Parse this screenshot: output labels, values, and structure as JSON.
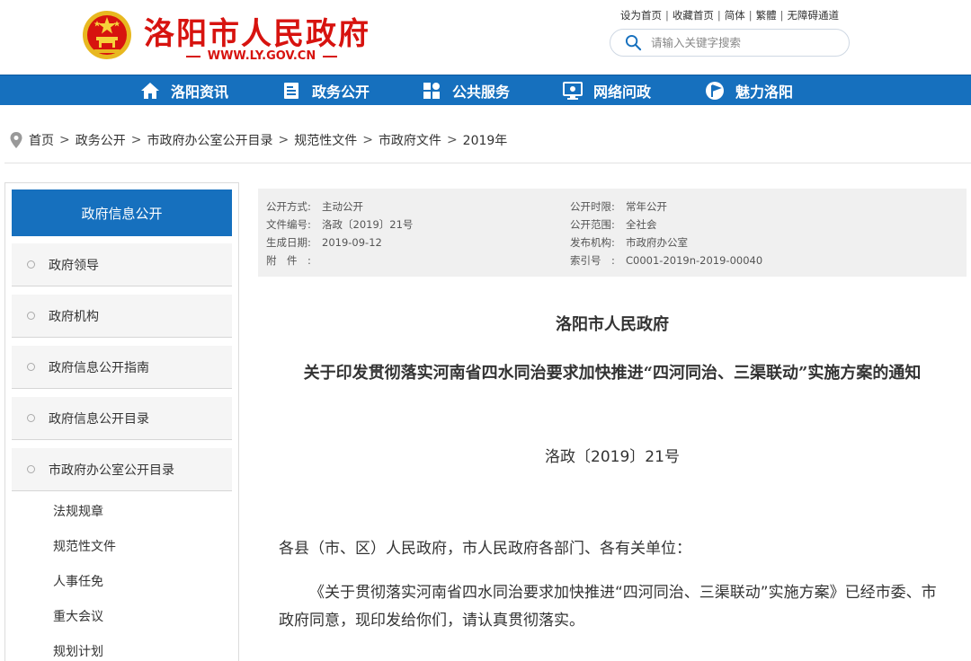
{
  "header": {
    "site_title": "洛阳市人民政府",
    "site_url": "WWW.LY.GOV.CN",
    "top_links": [
      "设为首页",
      "收藏首页",
      "简体",
      "繁體",
      "无障碍通道"
    ],
    "search_placeholder": "请输入关键字搜索",
    "brand_color": "#d7130f"
  },
  "nav": {
    "items": [
      {
        "label": "洛阳资讯",
        "icon": "home-icon"
      },
      {
        "label": "政务公开",
        "icon": "document-icon"
      },
      {
        "label": "公共服务",
        "icon": "grid-icon"
      },
      {
        "label": "网络问政",
        "icon": "monitor-icon"
      },
      {
        "label": "魅力洛阳",
        "icon": "flag-icon"
      }
    ],
    "bg_color": "#1670be"
  },
  "breadcrumb": [
    "首页",
    "政务公开",
    "市政府办公室公开目录",
    "规范性文件",
    "市政府文件",
    "2019年"
  ],
  "sidebar": {
    "heading": "政府信息公开",
    "items": [
      "政府领导",
      "政府机构",
      "政府信息公开指南",
      "政府信息公开目录",
      "市政府办公室公开目录"
    ],
    "sub_items": [
      "法规规章",
      "规范性文件",
      "人事任免",
      "重大会议",
      "规划计划"
    ]
  },
  "meta": {
    "publish_mode": {
      "label": "公开方式:",
      "value": "主动公开"
    },
    "doc_no": {
      "label": "文件编号:",
      "value": "洛政〔2019〕21号"
    },
    "date": {
      "label": "生成日期:",
      "value": "2019-09-12"
    },
    "attachment": {
      "label": "附　件　:",
      "value": ""
    },
    "period": {
      "label": "公开时限:",
      "value": "常年公开"
    },
    "scope": {
      "label": "公开范围:",
      "value": "全社会"
    },
    "issuer": {
      "label": "发布机构:",
      "value": "市政府办公室"
    },
    "index": {
      "label": "索引号　:",
      "value": "C0001-2019n-2019-00040"
    }
  },
  "document": {
    "issuer": "洛阳市人民政府",
    "title": "关于印发贯彻落实河南省四水同治要求加快推进“四河同治、三渠联动”实施方案的通知",
    "number": "洛政〔2019〕21号",
    "salutation": "各县（市、区）人民政府，市人民政府各部门、各有关单位：",
    "body": "《关于贯彻落实河南省四水同治要求加快推进“四河同治、三渠联动”实施方案》已经市委、市政府同意，现印发给你们，请认真贯彻落实。"
  }
}
